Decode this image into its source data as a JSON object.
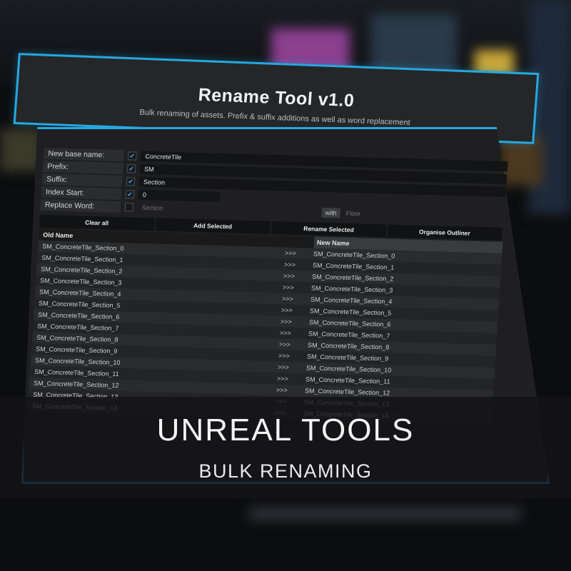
{
  "window": {
    "title": "Rename Tool v1.0",
    "subtitle": "Bulk renaming of assets. Prefix & suffix additions as well as word replacement"
  },
  "form": {
    "base_name": {
      "label": "New base name:",
      "checked": true,
      "value": "ConcreteTile"
    },
    "prefix": {
      "label": "Prefix:",
      "checked": true,
      "value": "SM"
    },
    "suffix": {
      "label": "Suffix:",
      "checked": true,
      "value": "Section"
    },
    "index_start": {
      "label": "Index Start:",
      "checked": true,
      "value": "0"
    },
    "replace_word": {
      "label": "Replace Word:",
      "checked": false,
      "value": "Section",
      "with_label": "with",
      "with_value": "Floor"
    }
  },
  "buttons": {
    "clear_all": "Clear all",
    "add_selected": "Add Selected",
    "rename_selected": "Rename Selected",
    "organise_outliner": "Organise Outliner"
  },
  "table": {
    "col_old": "Old Name",
    "col_new": "New Name",
    "arrow": ">>>",
    "rows": [
      {
        "old": "SM_ConcreteTile_Section_0",
        "new": "SM_ConcreteTile_Section_0"
      },
      {
        "old": "SM_ConcreteTile_Section_1",
        "new": "SM_ConcreteTile_Section_1"
      },
      {
        "old": "SM_ConcreteTile_Section_2",
        "new": "SM_ConcreteTile_Section_2"
      },
      {
        "old": "SM_ConcreteTile_Section_3",
        "new": "SM_ConcreteTile_Section_3"
      },
      {
        "old": "SM_ConcreteTile_Section_4",
        "new": "SM_ConcreteTile_Section_4"
      },
      {
        "old": "SM_ConcreteTile_Section_5",
        "new": "SM_ConcreteTile_Section_5"
      },
      {
        "old": "SM_ConcreteTile_Section_6",
        "new": "SM_ConcreteTile_Section_6"
      },
      {
        "old": "SM_ConcreteTile_Section_7",
        "new": "SM_ConcreteTile_Section_7"
      },
      {
        "old": "SM_ConcreteTile_Section_8",
        "new": "SM_ConcreteTile_Section_8"
      },
      {
        "old": "SM_ConcreteTile_Section_9",
        "new": "SM_ConcreteTile_Section_9"
      },
      {
        "old": "SM_ConcreteTile_Section_10",
        "new": "SM_ConcreteTile_Section_10"
      },
      {
        "old": "SM_ConcreteTile_Section_11",
        "new": "SM_ConcreteTile_Section_11"
      },
      {
        "old": "SM_ConcreteTile_Section_12",
        "new": "SM_ConcreteTile_Section_12"
      },
      {
        "old": "SM_ConcreteTile_Section_13",
        "new": "SM_ConcreteTile_Section_13"
      },
      {
        "old": "SM_ConcreteTile_Section_14",
        "new": "SM_ConcreteTile_Section_14"
      }
    ]
  },
  "banner": {
    "line1": "UNREAL TOOLS",
    "line2": "BULK RENAMING"
  },
  "colors": {
    "accent": "#26a8e0",
    "checkbox": "#3aa4ff",
    "panel": "#1f1f21"
  }
}
